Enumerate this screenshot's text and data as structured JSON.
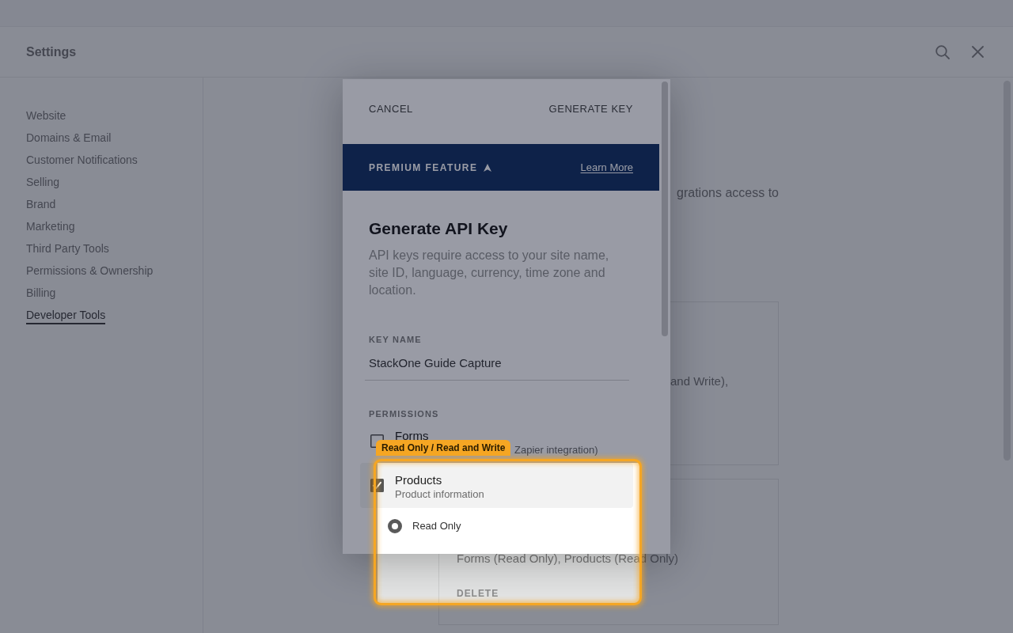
{
  "header": {
    "title": "Settings"
  },
  "sidebar": {
    "items": [
      {
        "label": "Website",
        "selected": false
      },
      {
        "label": "Domains & Email",
        "selected": false
      },
      {
        "label": "Customer Notifications",
        "selected": false
      },
      {
        "label": "Selling",
        "selected": false
      },
      {
        "label": "Brand",
        "selected": false
      },
      {
        "label": "Marketing",
        "selected": false
      },
      {
        "label": "Third Party Tools",
        "selected": false
      },
      {
        "label": "Permissions & Ownership",
        "selected": false
      },
      {
        "label": "Billing",
        "selected": false
      },
      {
        "label": "Developer Tools",
        "selected": true
      }
    ]
  },
  "page": {
    "intro_fragment": "grations access to",
    "cards": [
      {
        "text": "and Write),"
      },
      {
        "text": "Forms (Read Only), Products (Read Only)",
        "action": "DELETE"
      }
    ]
  },
  "dialog": {
    "cancel": "CANCEL",
    "confirm": "GENERATE KEY",
    "banner": {
      "label": "PREMIUM FEATURE",
      "link": "Learn More"
    },
    "title": "Generate API Key",
    "description": "API keys require access to your site name, site ID, language, currency, time zone and location.",
    "key_name": {
      "label": "KEY NAME",
      "value": "StackOne Guide Capture"
    },
    "permissions": {
      "label": "PERMISSIONS",
      "items": [
        {
          "name": "Forms",
          "description": "Zapier integration)",
          "checked": false,
          "expanded": false
        },
        {
          "name": "Products",
          "description": "Product information",
          "checked": true,
          "expanded": true,
          "options": [
            {
              "label": "Read Only",
              "selected": true
            }
          ]
        }
      ]
    }
  },
  "guide": {
    "tag": "Read Only / Read and Write"
  }
}
